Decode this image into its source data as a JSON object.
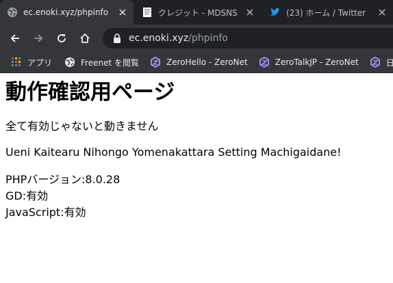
{
  "browser": {
    "tabs": [
      {
        "title": "ec.enoki.xyz/phpinfo",
        "active": true,
        "icon": "globe-icon"
      },
      {
        "title": "クレジット - MDSNS Crea",
        "active": false,
        "icon": "document-icon"
      },
      {
        "title": "(23) ホーム / Twitter",
        "active": false,
        "icon": "twitter-bird-icon"
      }
    ],
    "address": {
      "host": "ec.enoki.xyz",
      "path": "/phpinfo"
    },
    "bookmarks": [
      {
        "label": "アプリ",
        "icon": "apps-grid-icon"
      },
      {
        "label": "Freenet を閲覧",
        "icon": "globe-icon"
      },
      {
        "label": "ZeroHello - ZeroNet",
        "icon": "zeronet-icon"
      },
      {
        "label": "ZeroTalkJP - ZeroNet",
        "icon": "zeronet-icon"
      },
      {
        "label": "日本語掲示",
        "icon": "zeronet-icon"
      }
    ]
  },
  "page": {
    "heading": "動作確認用ページ",
    "notice": "全て有効じゃないと動きません",
    "romaji_notice": "Ueni Kaitearu Nihongo Yomenakattara Setting Machigaidane!",
    "info_lines": [
      "PHPバージョン:8.0.28",
      "GD:有効",
      "JavaScript:有効"
    ]
  },
  "colors": {
    "tabstrip": "#202124",
    "toolbar": "#35363a",
    "zeronet_purple": "#a48cf0",
    "twitter_blue": "#1d9bf0",
    "apps_colors": [
      "#ea4335",
      "#fbbc04",
      "#34a853",
      "#4285f4"
    ]
  }
}
